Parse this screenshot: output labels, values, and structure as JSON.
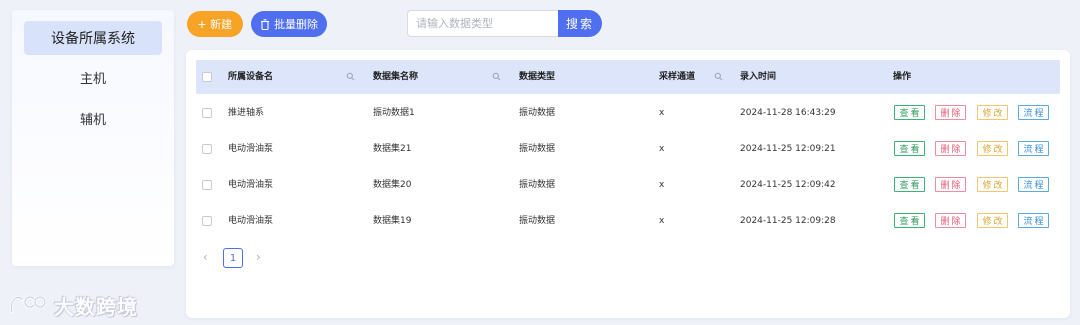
{
  "sidebar": {
    "items": [
      {
        "label": "设备所属系统",
        "active": true
      },
      {
        "label": "主机",
        "active": false
      },
      {
        "label": "辅机",
        "active": false
      }
    ]
  },
  "toolbar": {
    "new_label": "新建",
    "batch_delete_label": "批量删除",
    "search_placeholder": "请输入数据类型",
    "search_value": "",
    "search_label": "搜索"
  },
  "table": {
    "columns": [
      "所属设备名",
      "数据集名称",
      "数据类型",
      "采样通道",
      "录入时间",
      "操作"
    ],
    "rows": [
      {
        "device": "推进轴系",
        "dataset": "振动数据1",
        "type": "振动数据",
        "channel": "x",
        "time": "2024-11-28 16:43:29"
      },
      {
        "device": "电动滑油泵",
        "dataset": "数据集21",
        "type": "振动数据",
        "channel": "x",
        "time": "2024-11-25 12:09:21"
      },
      {
        "device": "电动滑油泵",
        "dataset": "数据集20",
        "type": "振动数据",
        "channel": "x",
        "time": "2024-11-25 12:09:42"
      },
      {
        "device": "电动滑油泵",
        "dataset": "数据集19",
        "type": "振动数据",
        "channel": "x",
        "time": "2024-11-25 12:09:28"
      }
    ],
    "actions": {
      "view": "查看",
      "delete": "删除",
      "edit": "修改",
      "flow": "流程"
    }
  },
  "pagination": {
    "prev": "‹",
    "current_page": "1",
    "next": "›"
  },
  "watermark": {
    "text": "大数跨境"
  },
  "colors": {
    "primary": "#4f6ff0",
    "new_button": "#f7a326",
    "view": "#2e9b5e",
    "delete": "#e05a74",
    "edit": "#d9a430",
    "flow": "#3a8fd8"
  }
}
